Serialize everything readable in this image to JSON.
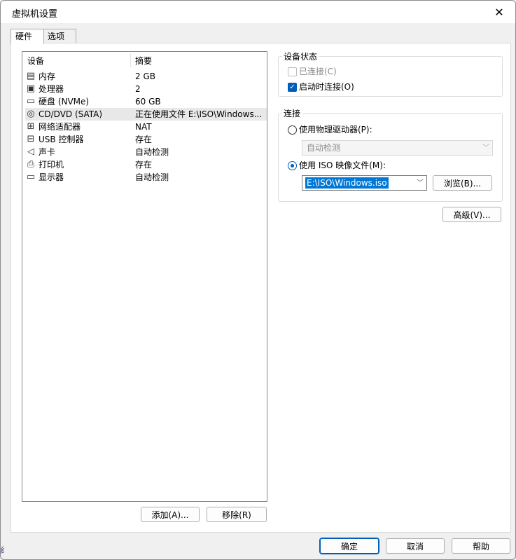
{
  "window": {
    "title": "虚拟机设置",
    "close_glyph": "✕"
  },
  "tabs": [
    {
      "label": "硬件"
    },
    {
      "label": "选项"
    }
  ],
  "list": {
    "headers": {
      "device": "设备",
      "summary": "摘要"
    },
    "items": [
      {
        "name": "内存",
        "summary": "2 GB",
        "icon": "memory-icon",
        "glyph": "▤"
      },
      {
        "name": "处理器",
        "summary": "2",
        "icon": "processor-icon",
        "glyph": "▣"
      },
      {
        "name": "硬盘 (NVMe)",
        "summary": "60 GB",
        "icon": "hard-disk-icon",
        "glyph": "▭"
      },
      {
        "name": "CD/DVD (SATA)",
        "summary": "正在使用文件 E:\\ISO\\Windows...",
        "icon": "cd-dvd-icon",
        "glyph": "◎",
        "selected": true
      },
      {
        "name": "网络适配器",
        "summary": "NAT",
        "icon": "network-adapter-icon",
        "glyph": "⊞"
      },
      {
        "name": "USB 控制器",
        "summary": "存在",
        "icon": "usb-controller-icon",
        "glyph": "⊟"
      },
      {
        "name": "声卡",
        "summary": "自动检测",
        "icon": "sound-card-icon",
        "glyph": "◁"
      },
      {
        "name": "打印机",
        "summary": "存在",
        "icon": "printer-icon",
        "glyph": "⎙"
      },
      {
        "name": "显示器",
        "summary": "自动检测",
        "icon": "display-icon",
        "glyph": "▭"
      }
    ]
  },
  "list_buttons": {
    "add": "添加(A)...",
    "remove": "移除(R)"
  },
  "device_status": {
    "label": "设备状态",
    "connected": {
      "label": "已连接(C)",
      "checked": false,
      "enabled": false
    },
    "connect_at_power_on": {
      "label": "启动时连接(O)",
      "checked": true,
      "enabled": true
    }
  },
  "connection": {
    "label": "连接",
    "physical_drive": {
      "label": "使用物理驱动器(P):",
      "selected": false
    },
    "physical_drive_combo": {
      "value": "自动检测"
    },
    "iso_image": {
      "label": "使用 ISO 映像文件(M):",
      "selected": true
    },
    "iso_path": {
      "value": "E:\\ISO\\Windows.iso"
    },
    "browse": "浏览(B)..."
  },
  "advanced": "高级(V)...",
  "footer": {
    "ok": "确定",
    "cancel": "取消",
    "help": "帮助"
  },
  "edge_text": "纟",
  "colors": {
    "accent": "#005fb8",
    "selection": "#0078d7"
  }
}
